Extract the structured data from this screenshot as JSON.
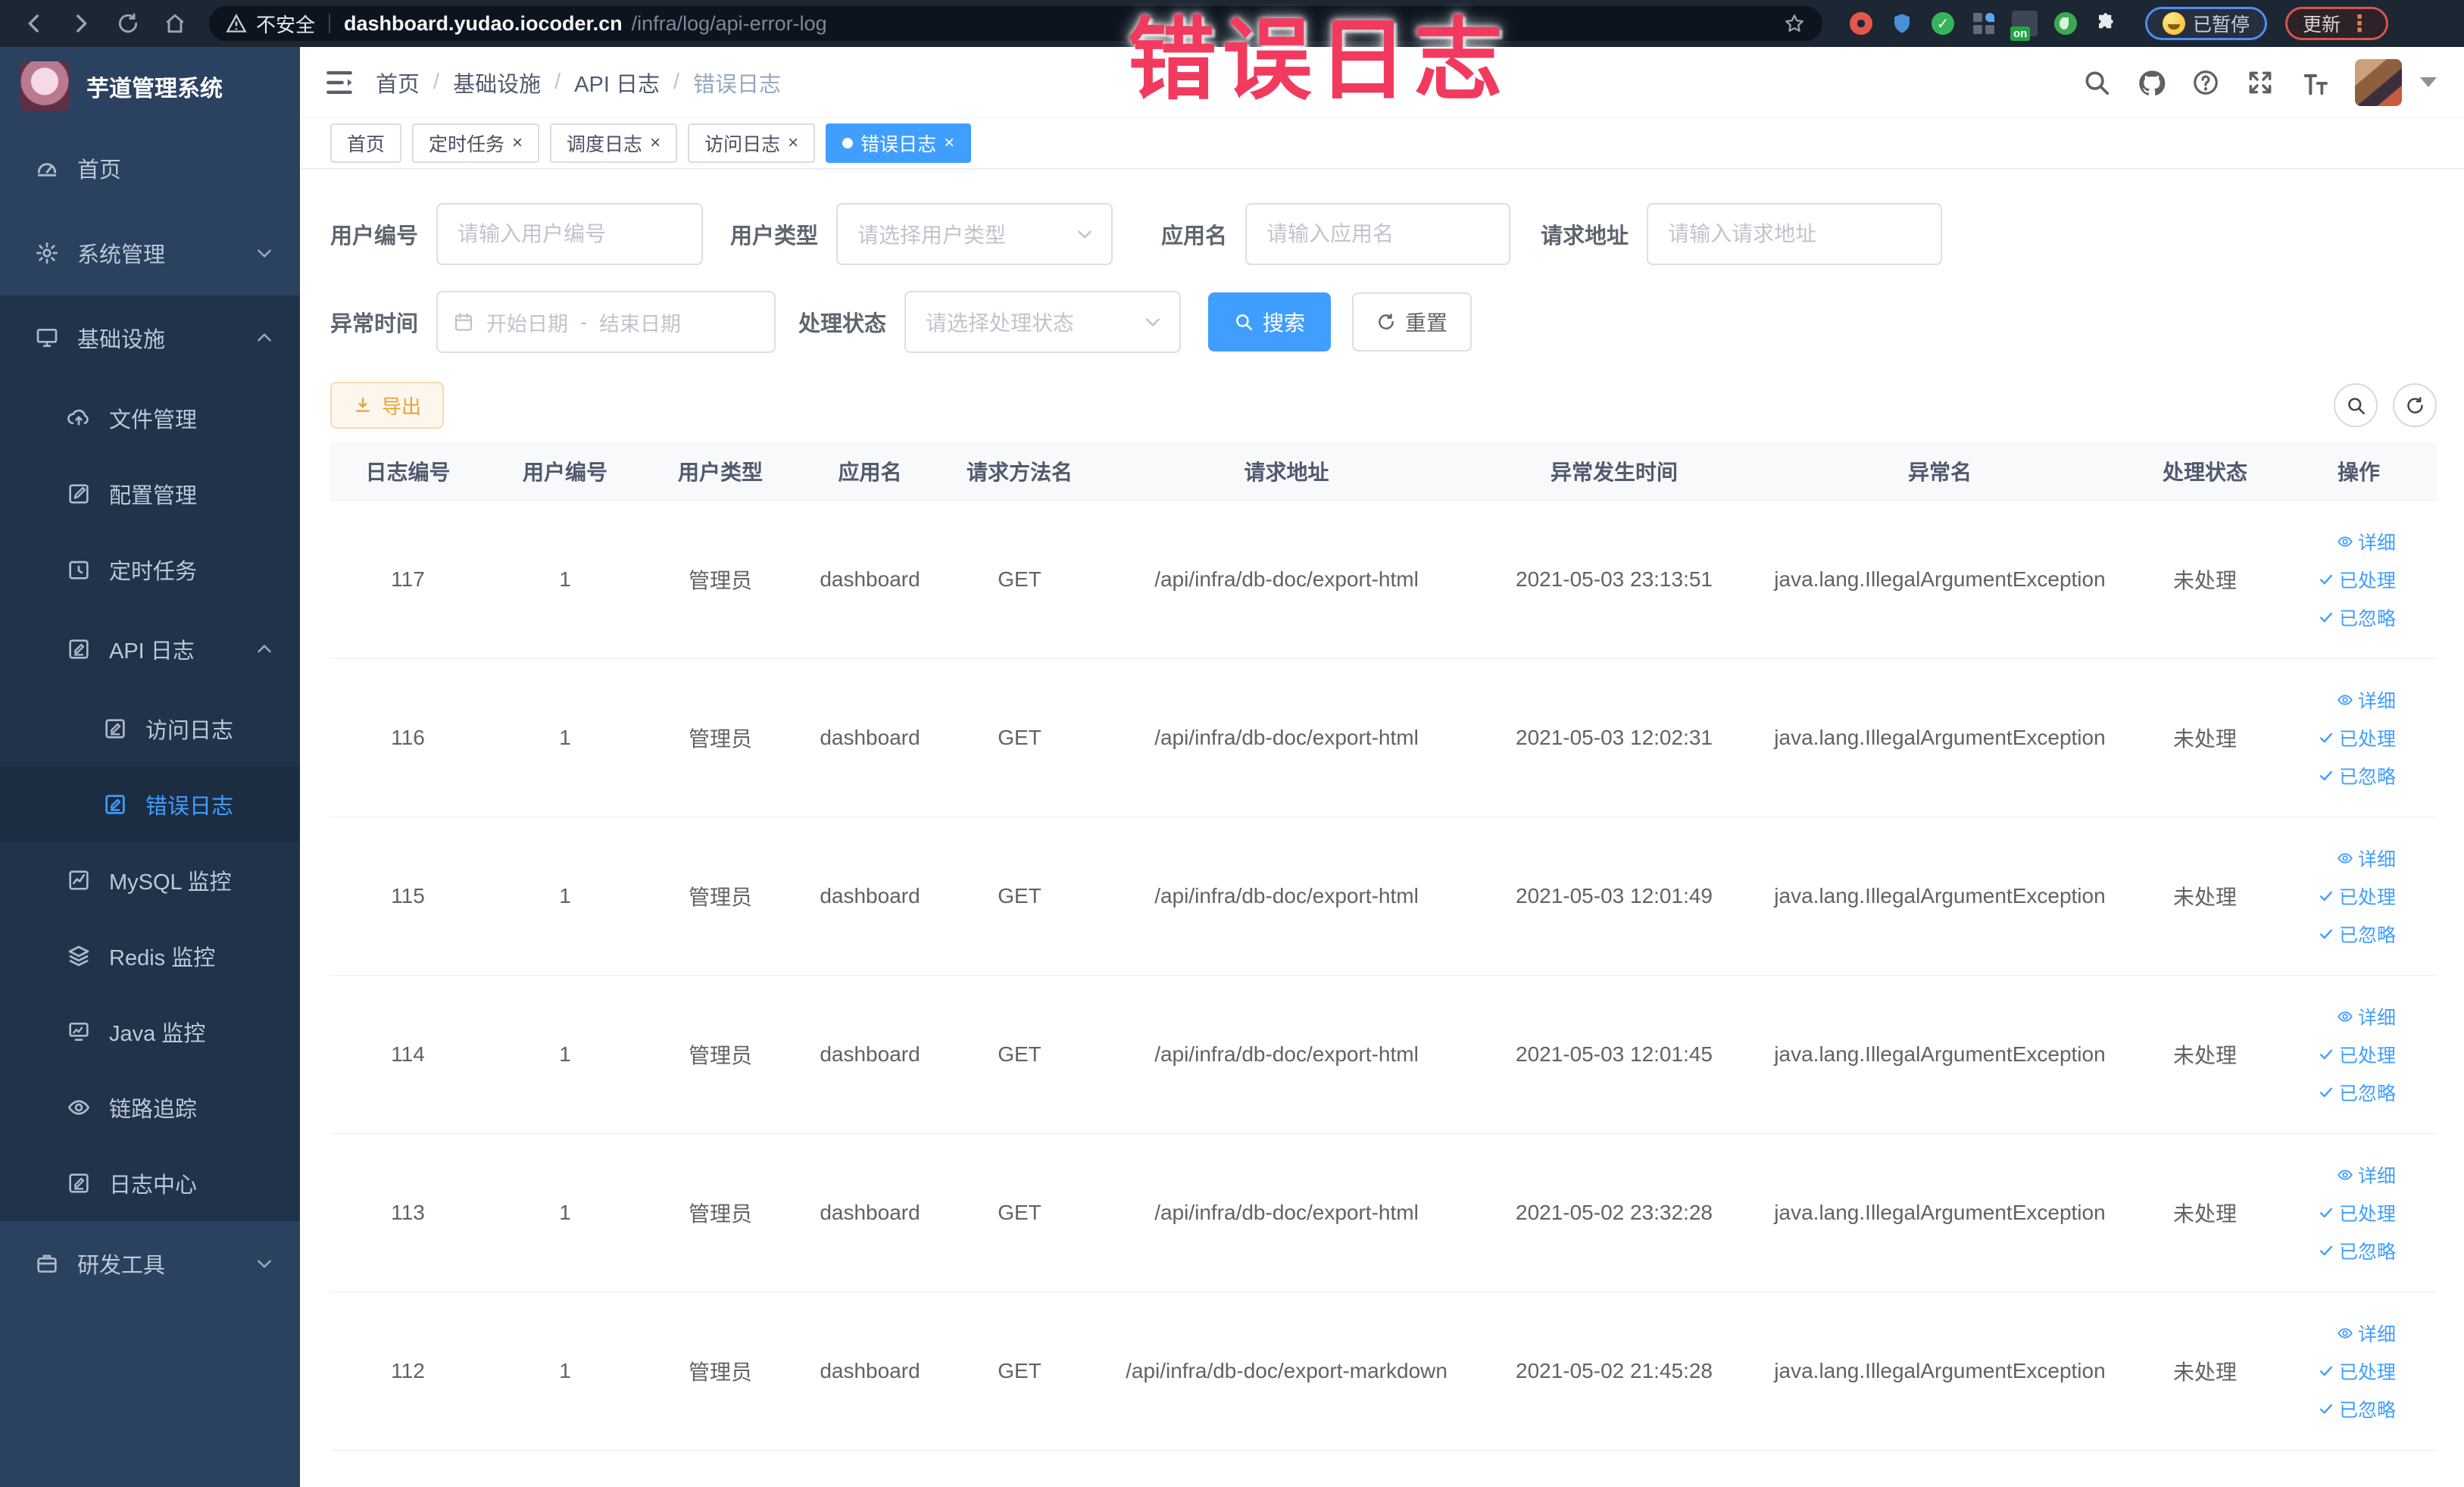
{
  "browser": {
    "security_label": "不安全",
    "url_domain": "dashboard.yudao.iocoder.cn",
    "url_path": "/infra/log/api-error-log",
    "paused_label": "已暂停",
    "update_label": "更新",
    "kebab_glyph": "⋮"
  },
  "annotation": {
    "text": "错误日志",
    "color": "#f23a5f"
  },
  "sidebar": {
    "logo_title": "芋道管理系统",
    "items": [
      {
        "label": "首页"
      },
      {
        "label": "系统管理"
      },
      {
        "label": "基础设施"
      },
      {
        "label": "文件管理"
      },
      {
        "label": "配置管理"
      },
      {
        "label": "定时任务"
      },
      {
        "label": "API 日志"
      },
      {
        "label": "访问日志"
      },
      {
        "label": "错误日志"
      },
      {
        "label": "MySQL 监控"
      },
      {
        "label": "Redis 监控"
      },
      {
        "label": "Java 监控"
      },
      {
        "label": "链路追踪"
      },
      {
        "label": "日志中心"
      },
      {
        "label": "研发工具"
      }
    ]
  },
  "header": {
    "breadcrumb": [
      "首页",
      "基础设施",
      "API 日志",
      "错误日志"
    ],
    "separator": "/"
  },
  "tabs": [
    {
      "label": "首页"
    },
    {
      "label": "定时任务"
    },
    {
      "label": "调度日志"
    },
    {
      "label": "访问日志"
    },
    {
      "label": "错误日志"
    }
  ],
  "tab_close_glyph": "×",
  "filters": {
    "user_id_label": "用户编号",
    "user_id_placeholder": "请输入用户编号",
    "user_type_label": "用户类型",
    "user_type_placeholder": "请选择用户类型",
    "app_name_label": "应用名",
    "app_name_placeholder": "请输入应用名",
    "request_url_label": "请求地址",
    "request_url_placeholder": "请输入请求地址",
    "exception_time_label": "异常时间",
    "date_start_placeholder": "开始日期",
    "date_separator": "-",
    "date_end_placeholder": "结束日期",
    "process_status_label": "处理状态",
    "process_status_placeholder": "请选择处理状态",
    "search_label": "搜索",
    "reset_label": "重置"
  },
  "toolbar": {
    "export_label": "导出"
  },
  "table": {
    "columns": [
      "日志编号",
      "用户编号",
      "用户类型",
      "应用名",
      "请求方法名",
      "请求地址",
      "异常发生时间",
      "异常名",
      "处理状态",
      "操作"
    ],
    "action_labels": {
      "detail": "详细",
      "processed": "已处理",
      "ignored": "已忽略"
    },
    "rows": [
      {
        "id": "117",
        "user_id": "1",
        "user_type": "管理员",
        "app": "dashboard",
        "method": "GET",
        "url": "/api/infra/db-doc/export-html",
        "time": "2021-05-03 23:13:51",
        "exception": "java.lang.IllegalArgumentException",
        "status": "未处理"
      },
      {
        "id": "116",
        "user_id": "1",
        "user_type": "管理员",
        "app": "dashboard",
        "method": "GET",
        "url": "/api/infra/db-doc/export-html",
        "time": "2021-05-03 12:02:31",
        "exception": "java.lang.IllegalArgumentException",
        "status": "未处理"
      },
      {
        "id": "115",
        "user_id": "1",
        "user_type": "管理员",
        "app": "dashboard",
        "method": "GET",
        "url": "/api/infra/db-doc/export-html",
        "time": "2021-05-03 12:01:49",
        "exception": "java.lang.IllegalArgumentException",
        "status": "未处理"
      },
      {
        "id": "114",
        "user_id": "1",
        "user_type": "管理员",
        "app": "dashboard",
        "method": "GET",
        "url": "/api/infra/db-doc/export-html",
        "time": "2021-05-03 12:01:45",
        "exception": "java.lang.IllegalArgumentException",
        "status": "未处理"
      },
      {
        "id": "113",
        "user_id": "1",
        "user_type": "管理员",
        "app": "dashboard",
        "method": "GET",
        "url": "/api/infra/db-doc/export-html",
        "time": "2021-05-02 23:32:28",
        "exception": "java.lang.IllegalArgumentException",
        "status": "未处理"
      },
      {
        "id": "112",
        "user_id": "1",
        "user_type": "管理员",
        "app": "dashboard",
        "method": "GET",
        "url": "/api/infra/db-doc/export-markdown",
        "time": "2021-05-02 21:45:28",
        "exception": "java.lang.IllegalArgumentException",
        "status": "未处理"
      }
    ]
  },
  "colors": {
    "accent": "#409eff",
    "warn": "#e6a23c",
    "annotation": "#f23a5f",
    "sidebar_bg": "#2a4160",
    "sidebar_sub_bg": "#20334b"
  }
}
